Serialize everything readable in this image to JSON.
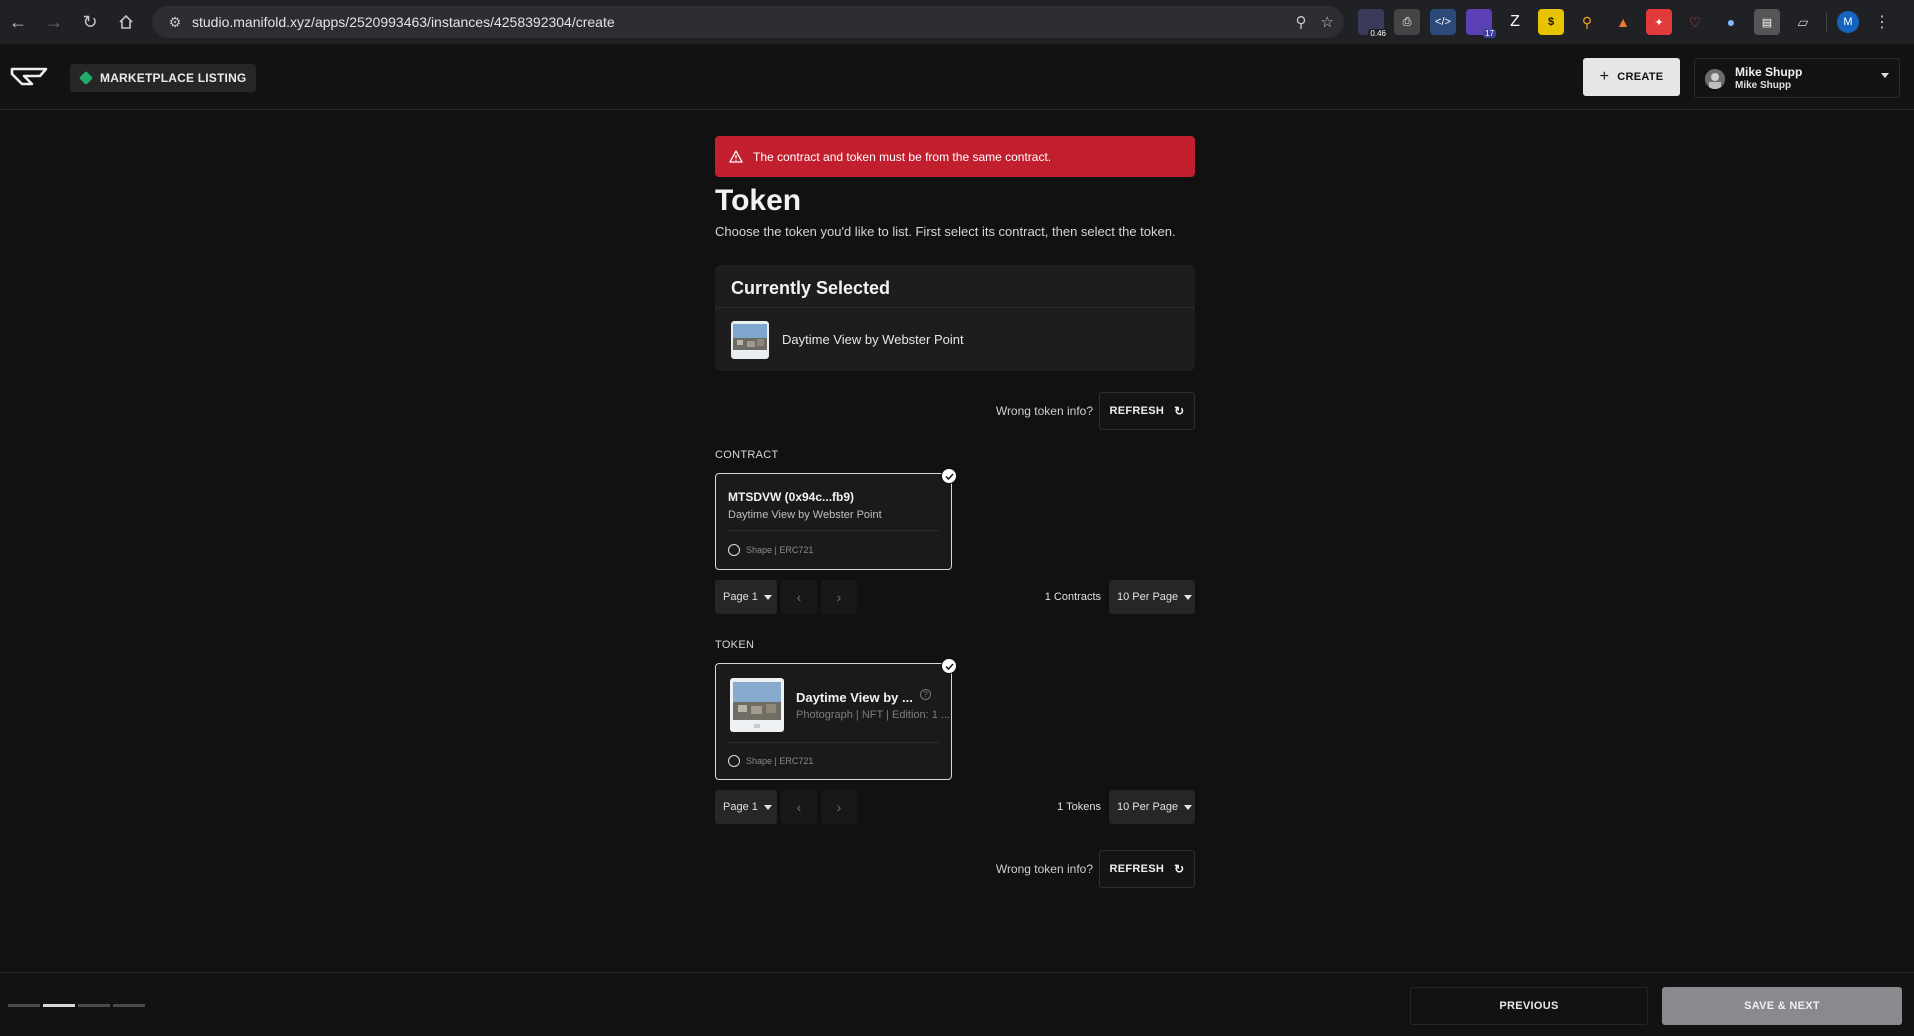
{
  "browser": {
    "url": "studio.manifold.xyz/apps/2520993463/instances/4258392304/create",
    "ext_badge_1": "0.46",
    "ext_badge_2": "17",
    "profile_initial": "M"
  },
  "header": {
    "chip_label": "MARKETPLACE LISTING",
    "create_label": "CREATE",
    "user_name": "Mike Shupp",
    "user_handle": "Mike Shupp"
  },
  "alert": {
    "message": "The contract and token must be from the same contract."
  },
  "page": {
    "title": "Token",
    "subtitle": "Choose the token you'd like to list. First select its contract, then select the token."
  },
  "selected": {
    "heading": "Currently Selected",
    "name": "Daytime View by Webster Point"
  },
  "refresh": {
    "question": "Wrong token info?",
    "label": "REFRESH"
  },
  "contract": {
    "section_label": "CONTRACT",
    "title": "MTSDVW (0x94c...fb9)",
    "subtitle": "Daytime View by Webster Point",
    "footer": "Shape | ERC721",
    "page_label": "Page 1",
    "count_label": "1 Contracts",
    "per_page": "10 Per Page"
  },
  "token": {
    "section_label": "TOKEN",
    "title": "Daytime View by ...",
    "subtitle": "Photograph | NFT | Edition: 1 ...",
    "footer": "Shape | ERC721",
    "page_label": "Page 1",
    "count_label": "1 Tokens",
    "per_page": "10 Per Page"
  },
  "footer": {
    "previous_label": "PREVIOUS",
    "next_label": "SAVE & NEXT",
    "current_step": 2,
    "total_steps": 4
  },
  "colors": {
    "alert": "#c21f2e",
    "tag": "#21a86b",
    "next_button": "#8a8a8e"
  }
}
